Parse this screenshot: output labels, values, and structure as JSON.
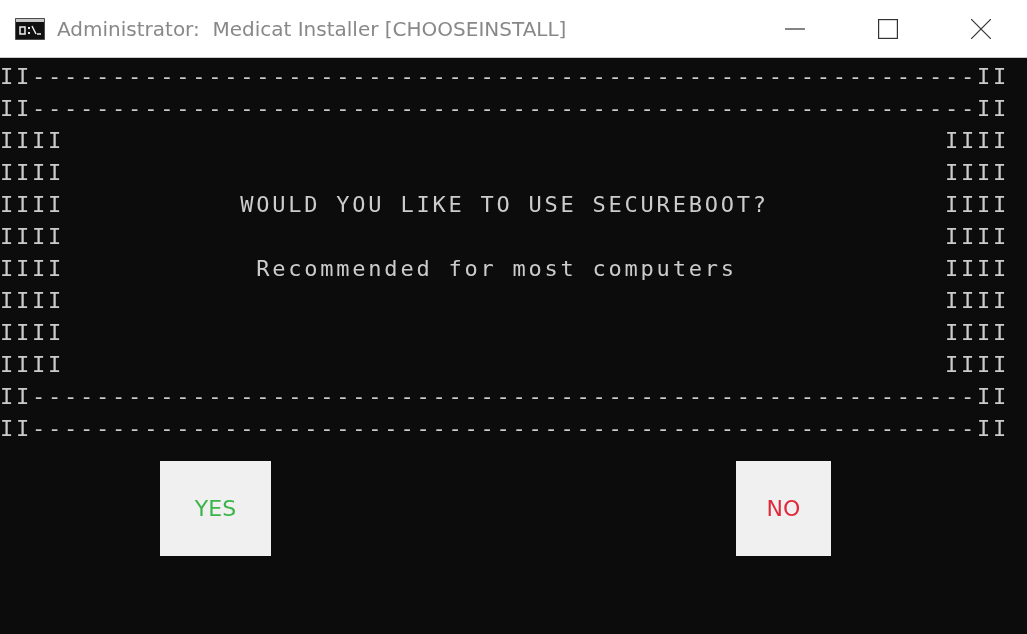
{
  "window": {
    "title": "Administrator:  Medicat Installer [CHOOSEINSTALL]"
  },
  "console_lines": [
    "II-----------------------------------------------------------II",
    "II-----------------------------------------------------------II",
    "IIII                                                       IIII",
    "IIII                                                       IIII",
    "IIII           WOULD YOU LIKE TO USE SECUREBOOT?           IIII",
    "IIII                                                       IIII",
    "IIII            Recommended for most computers             IIII",
    "IIII                                                       IIII",
    "IIII                                                       IIII",
    "IIII                                                       IIII",
    "II-----------------------------------------------------------II",
    "II-----------------------------------------------------------II"
  ],
  "buttons": [
    {
      "label": "YES",
      "kind": "yes"
    },
    {
      "label": "NO",
      "kind": "no"
    }
  ]
}
